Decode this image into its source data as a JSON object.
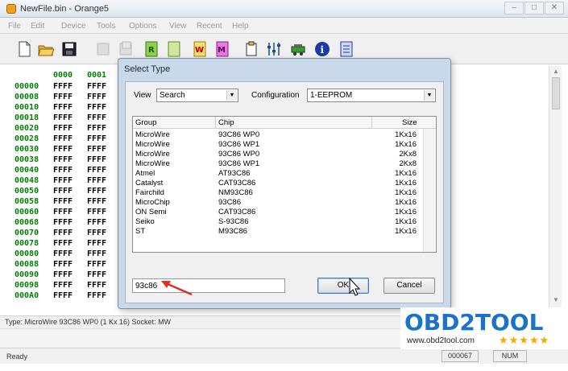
{
  "window": {
    "title": "NewFile.bin - Orange5"
  },
  "menu": [
    "File",
    "Edit",
    "Device",
    "Tools",
    "Options",
    "View",
    "Recent",
    "Help"
  ],
  "toolbar_icons": [
    "new-file-icon",
    "open-folder-icon",
    "save-icon",
    "disabled-icon",
    "disabled-icon",
    "read-icon",
    "blank-icon",
    "write-icon",
    "verify-icon",
    "copy-icon",
    "settings-icon",
    "device-icon",
    "info-icon",
    "notes-icon"
  ],
  "hex": {
    "headers": [
      "0000",
      "0001"
    ],
    "rows": [
      {
        "addr": "00000",
        "v0": "FFFF",
        "v1": "FFFF"
      },
      {
        "addr": "00008",
        "v0": "FFFF",
        "v1": "FFFF"
      },
      {
        "addr": "00010",
        "v0": "FFFF",
        "v1": "FFFF"
      },
      {
        "addr": "00018",
        "v0": "FFFF",
        "v1": "FFFF"
      },
      {
        "addr": "00020",
        "v0": "FFFF",
        "v1": "FFFF"
      },
      {
        "addr": "00028",
        "v0": "FFFF",
        "v1": "FFFF"
      },
      {
        "addr": "00030",
        "v0": "FFFF",
        "v1": "FFFF"
      },
      {
        "addr": "00038",
        "v0": "FFFF",
        "v1": "FFFF"
      },
      {
        "addr": "00040",
        "v0": "FFFF",
        "v1": "FFFF"
      },
      {
        "addr": "00048",
        "v0": "FFFF",
        "v1": "FFFF"
      },
      {
        "addr": "00050",
        "v0": "FFFF",
        "v1": "FFFF"
      },
      {
        "addr": "00058",
        "v0": "FFFF",
        "v1": "FFFF"
      },
      {
        "addr": "00060",
        "v0": "FFFF",
        "v1": "FFFF"
      },
      {
        "addr": "00068",
        "v0": "FFFF",
        "v1": "FFFF"
      },
      {
        "addr": "00070",
        "v0": "FFFF",
        "v1": "FFFF"
      },
      {
        "addr": "00078",
        "v0": "FFFF",
        "v1": "FFFF"
      },
      {
        "addr": "00080",
        "v0": "FFFF",
        "v1": "FFFF"
      },
      {
        "addr": "00088",
        "v0": "FFFF",
        "v1": "FFFF"
      },
      {
        "addr": "00090",
        "v0": "FFFF",
        "v1": "FFFF"
      },
      {
        "addr": "00098",
        "v0": "FFFF",
        "v1": "FFFF"
      },
      {
        "addr": "000A0",
        "v0": "FFFF",
        "v1": "FFFF"
      }
    ]
  },
  "info_line": "Type: MicroWire 93C86 WP0 (1 Kx 16)  Socket: MW",
  "status": {
    "ready": "Ready",
    "count": "000067",
    "num": "NUM"
  },
  "dialog": {
    "title": "Select Type",
    "view_label": "View",
    "view_value": "Search",
    "config_label": "Configuration",
    "config_value": "1-EEPROM",
    "columns": {
      "group": "Group",
      "chip": "Chip",
      "size": "Size"
    },
    "rows": [
      {
        "group": "MicroWire",
        "chip": "93C86 WP0",
        "size": "1Kx16"
      },
      {
        "group": "MicroWire",
        "chip": "93C86 WP1",
        "size": "1Kx16"
      },
      {
        "group": "MicroWire",
        "chip": "93C86 WP0",
        "size": "2Kx8"
      },
      {
        "group": "MicroWire",
        "chip": "93C86 WP1",
        "size": "2Kx8"
      },
      {
        "group": "Atmel",
        "chip": "AT93C86",
        "size": "1Kx16"
      },
      {
        "group": "Catalyst",
        "chip": "CAT93C86",
        "size": "1Kx16"
      },
      {
        "group": "Fairchild",
        "chip": "NM93C86",
        "size": "1Kx16"
      },
      {
        "group": "MicroChip",
        "chip": "93C86",
        "size": "1Kx16"
      },
      {
        "group": "ON Semi",
        "chip": "CAT93C86",
        "size": "1Kx16"
      },
      {
        "group": "Seiko",
        "chip": "S-93C86",
        "size": "1Kx16"
      },
      {
        "group": "ST",
        "chip": "M93C86",
        "size": "1Kx16"
      }
    ],
    "search_value": "93c86",
    "ok_label": "OK",
    "cancel_label": "Cancel"
  },
  "watermark": {
    "logo": "OBD2TOOL",
    "url": "www.obd2tool.com",
    "stars": "★★★★★"
  },
  "colors": {
    "address_green": "#008000",
    "dialog_frame": "#c9d9ea",
    "logo_blue": "#1a73c8",
    "arrow_red": "#e03020"
  }
}
